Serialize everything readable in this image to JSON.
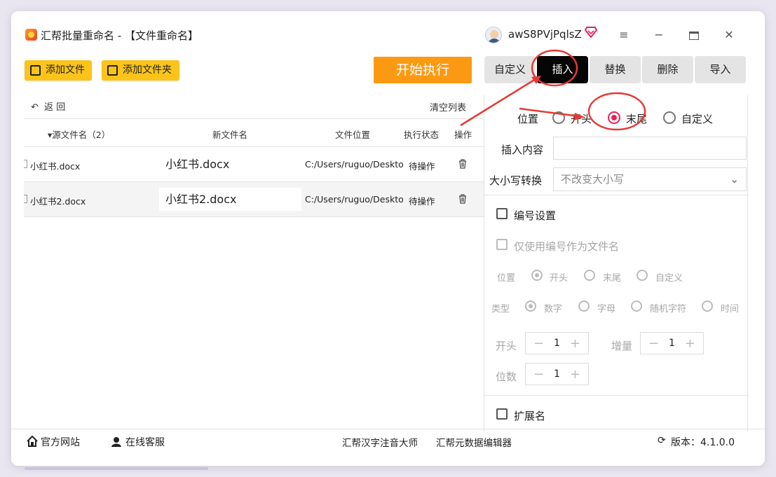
{
  "app": {
    "title": "汇帮批量重命名 - 【文件重命名】",
    "username": "awS8PVjPqlsZ"
  },
  "toolbar": {
    "add_file": "添加文件",
    "add_folder": "添加文件夹",
    "start": "开始执行"
  },
  "list": {
    "back": "返  回",
    "clear": "清空列表",
    "headers": {
      "orig": "▾源文件名（2）",
      "new": "新文件名",
      "location": "文件位置",
      "status": "执行状态",
      "action": "操作"
    },
    "rows": [
      {
        "orig": "小红书.docx",
        "new": "小红书.docx",
        "location": "C:/Users/ruguo/Deskto",
        "status": "待操作"
      },
      {
        "orig": "小红书2.docx",
        "new": "小红书2.docx",
        "location": "C:/Users/ruguo/Deskto",
        "status": "待操作"
      }
    ]
  },
  "tabs": [
    "自定义",
    "插入",
    "替换",
    "删除",
    "导入"
  ],
  "insert": {
    "position_label": "位置",
    "position_options": [
      "开头",
      "末尾",
      "自定义"
    ],
    "position_selected": "末尾",
    "content_label": "插入内容",
    "content_value": "",
    "case_label": "大小写转换",
    "case_value": "不改变大小写"
  },
  "numbering": {
    "label": "编号设置",
    "only_number": "仅使用编号作为文件名",
    "position_label": "位置",
    "position_options": [
      "开头",
      "末尾",
      "自定义"
    ],
    "type_label": "类型",
    "type_options": [
      "数字",
      "字母",
      "随机字符",
      "时间"
    ],
    "start_label": "开头",
    "start_value": "1",
    "increment_label": "增量",
    "increment_value": "1",
    "digits_label": "位数",
    "digits_value": "1"
  },
  "extension": {
    "label": "扩展名"
  },
  "footer": {
    "website": "官方网站",
    "support": "在线客服",
    "tool1": "汇帮汉字注音大师",
    "tool2": "汇帮元数据编辑器",
    "version": "版本：4.1.0.0"
  },
  "colors": {
    "accent": "#fcc419",
    "start": "#fb9a12",
    "active_tab": "#050505",
    "radio_on": "#e8225a",
    "annotation": "#e53935"
  }
}
